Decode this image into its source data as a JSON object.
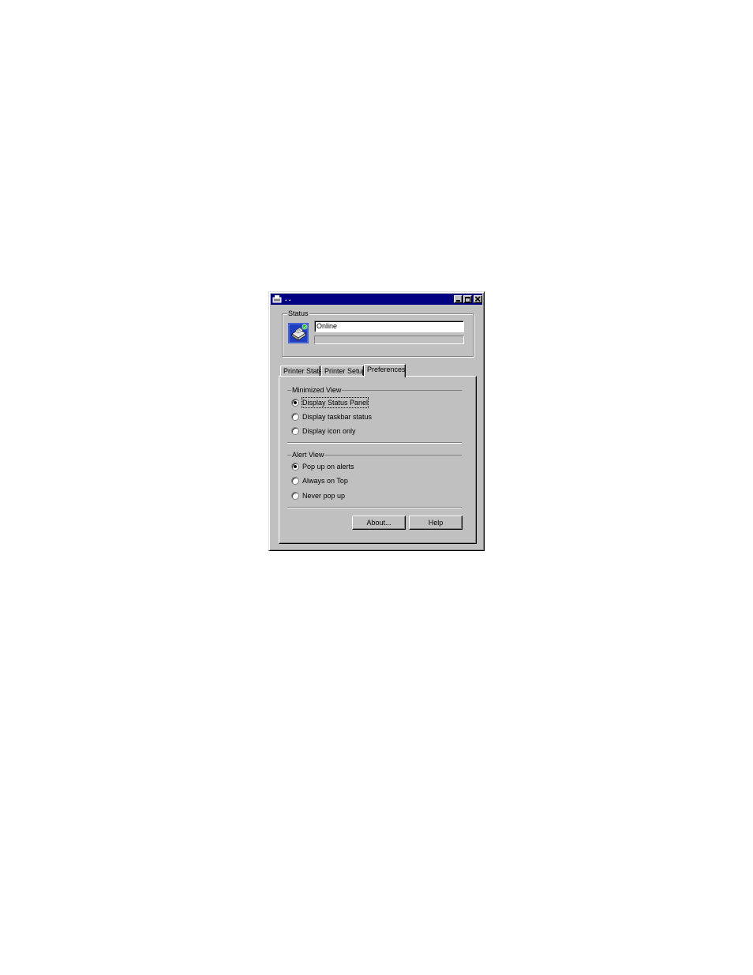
{
  "window": {
    "title": ". .",
    "titlebar_color": "#000080",
    "face_color": "#c0c0c0"
  },
  "status": {
    "group_label": "Status",
    "status_text": "Online",
    "icon": "printer-icon"
  },
  "tabs": [
    {
      "label": "Printer State",
      "active": false
    },
    {
      "label": "Printer Setup",
      "active": false
    },
    {
      "label": "Preferences",
      "active": true
    }
  ],
  "minimized_view": {
    "group_label": "Minimized View",
    "options": [
      {
        "label": "Display Status Panel",
        "checked": true
      },
      {
        "label": "Display taskbar status",
        "checked": false
      },
      {
        "label": "Display icon only",
        "checked": false
      }
    ]
  },
  "alert_view": {
    "group_label": "Alert View",
    "options": [
      {
        "label": "Pop up on alerts",
        "checked": true
      },
      {
        "label": "Always on Top",
        "checked": false
      },
      {
        "label": "Never pop up",
        "checked": false
      }
    ]
  },
  "buttons": {
    "about_label": "About...",
    "help_label": "Help"
  }
}
